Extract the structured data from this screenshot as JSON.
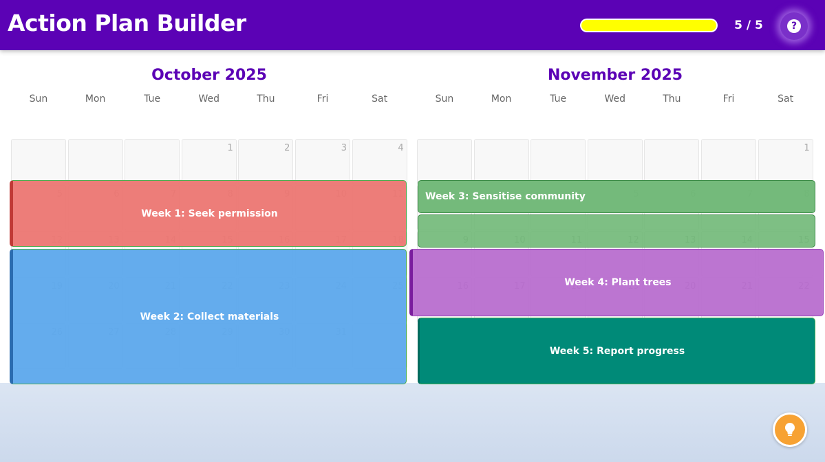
{
  "header": {
    "title": "Action Plan Builder",
    "progress_text": "5 / 5",
    "progress_fraction": 1.0,
    "help_icon": "question-icon",
    "help_glyph": "?"
  },
  "calendars": [
    {
      "month_label": "October 2025",
      "weekdays": [
        "Sun",
        "Mon",
        "Tue",
        "Wed",
        "Thu",
        "Fri",
        "Sat"
      ],
      "weeks": [
        [
          "",
          "",
          "",
          "1",
          "2",
          "3",
          "4"
        ],
        [
          "5",
          "6",
          "7",
          "8",
          "9",
          "10",
          "11"
        ],
        [
          "12",
          "13",
          "14",
          "15",
          "16",
          "17",
          "18"
        ],
        [
          "19",
          "20",
          "21",
          "22",
          "23",
          "24",
          "25"
        ],
        [
          "26",
          "27",
          "28",
          "29",
          "30",
          "31",
          ""
        ]
      ]
    },
    {
      "month_label": "November 2025",
      "weekdays": [
        "Sun",
        "Mon",
        "Tue",
        "Wed",
        "Thu",
        "Fri",
        "Sat"
      ],
      "weeks": [
        [
          "",
          "",
          "",
          "",
          "",
          "",
          "1"
        ],
        [
          "2",
          "3",
          "4",
          "5",
          "6",
          "7",
          "8"
        ],
        [
          "9",
          "10",
          "11",
          "12",
          "13",
          "14",
          "15"
        ],
        [
          "16",
          "17",
          "18",
          "19",
          "20",
          "21",
          "22"
        ]
      ]
    }
  ],
  "tasks": [
    {
      "label": "Week 1: Seek permission",
      "color": "#ec7672",
      "accent": "#c03a36"
    },
    {
      "label": "Week 2: Collect materials",
      "color": "#5ea9ec",
      "accent": "#2b6cb0"
    },
    {
      "label": "Week 3: Sensitise community",
      "color": "#70b877",
      "accent": "#3a8a45"
    },
    {
      "label": "Week 4: Plant trees",
      "color": "#b76acd",
      "accent": "#7a1d9e"
    },
    {
      "label": "Week 5: Report progress",
      "color": "#008a78",
      "accent": "#006b5e"
    }
  ],
  "hint": {
    "icon": "lightbulb-icon"
  },
  "colors": {
    "header_bg": "#5b02b5",
    "progress_fill": "#ffff00",
    "hint_button": "#f7a233"
  }
}
